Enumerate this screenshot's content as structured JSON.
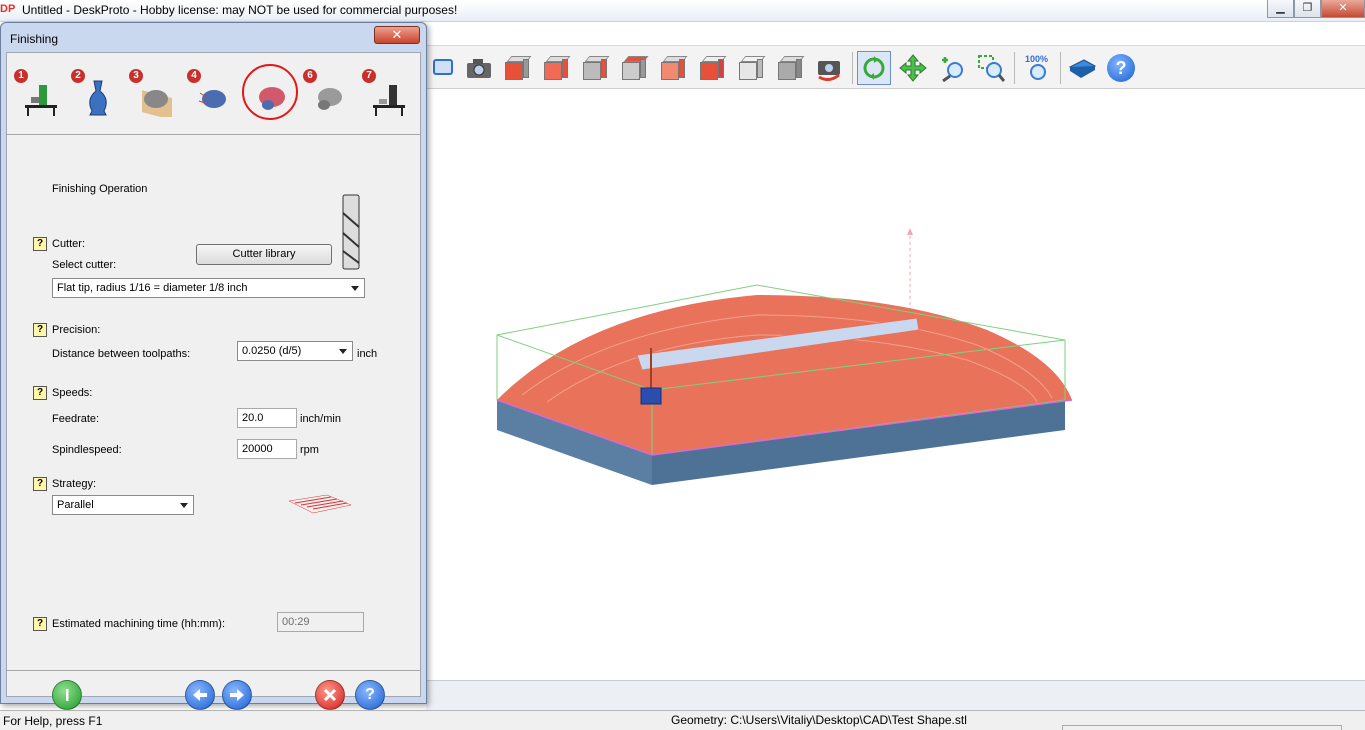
{
  "window": {
    "title": "Untitled - DeskProto - Hobby license: may NOT be used for commercial purposes!",
    "min": "▁",
    "max": "❐",
    "close": "✕"
  },
  "toolbar": {
    "buttons": [
      {
        "icon": "screen-icon"
      },
      {
        "icon": "camera-icon"
      },
      {
        "icon": "view-front-icon"
      },
      {
        "icon": "view-back-icon"
      },
      {
        "icon": "view-left-icon"
      },
      {
        "icon": "view-right-icon"
      },
      {
        "icon": "view-top-icon"
      },
      {
        "icon": "view-bottom-icon"
      },
      {
        "icon": "view-iso-icon"
      },
      {
        "icon": "view-solid-icon"
      },
      {
        "icon": "camera-reset-icon"
      },
      {
        "icon": "rotate-icon"
      },
      {
        "icon": "pan-icon"
      },
      {
        "icon": "zoom-icon"
      },
      {
        "icon": "zoom-window-icon"
      },
      {
        "icon": "zoom-100-icon"
      },
      {
        "icon": "manual-icon"
      },
      {
        "icon": "help-icon"
      }
    ],
    "zoom_100_label": "100%",
    "help_glyph": "?"
  },
  "dialog": {
    "title": "Finishing",
    "close_glyph": "✕",
    "steps": [
      {
        "num": "1",
        "name": "machine-setup"
      },
      {
        "num": "2",
        "name": "part-geometry"
      },
      {
        "num": "3",
        "name": "roughing"
      },
      {
        "num": "4",
        "name": "roughing-heat"
      },
      {
        "num": "",
        "name": "finishing"
      },
      {
        "num": "6",
        "name": "post-finishing"
      },
      {
        "num": "7",
        "name": "machine-output"
      }
    ],
    "section_title": "Finishing Operation",
    "cutter": {
      "label": "Cutter:",
      "select_label": "Select cutter:",
      "library_button": "Cutter library",
      "selected": "Flat tip, radius 1/16 = diameter 1/8 inch"
    },
    "precision": {
      "label": "Precision:",
      "distance_label": "Distance between toolpaths:",
      "distance_value": "0.0250  (d/5)",
      "unit": "inch"
    },
    "speeds": {
      "label": "Speeds:",
      "feedrate_label": "Feedrate:",
      "feedrate_value": "20.0",
      "feedrate_unit": "inch/min",
      "spindle_label": "Spindlespeed:",
      "spindle_value": "20000",
      "spindle_unit": "rpm"
    },
    "strategy": {
      "label": "Strategy:",
      "selected": "Parallel"
    },
    "estimate": {
      "label": "Estimated machining time (hh:mm):",
      "value": "00:29"
    },
    "q": "?"
  },
  "status": {
    "help": "For Help, press F1",
    "geometry": "Geometry: C:\\Users\\Vitaliy\\Desktop\\CAD\\Test Shape.stl"
  },
  "colors": {
    "part_top": "#e8735a",
    "part_body": "#5a7fa3",
    "bbox": "#7ed07e",
    "accent_blue": "#2f6fd0"
  }
}
